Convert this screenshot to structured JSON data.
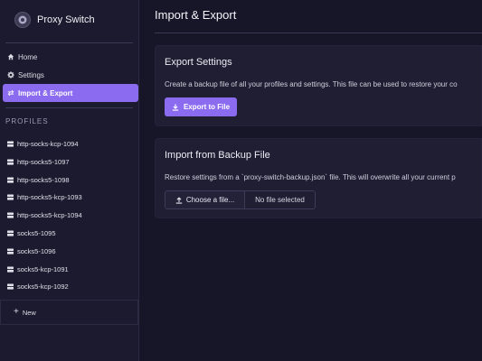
{
  "app": {
    "name": "Proxy Switch"
  },
  "nav": [
    {
      "label": "Home",
      "icon": "home-icon"
    },
    {
      "label": "Settings",
      "icon": "gear-icon"
    },
    {
      "label": "Import & Export",
      "icon": "swap-arrows-icon",
      "active": true
    }
  ],
  "profiles_title": "PROFILES",
  "profiles": [
    "http-socks-kcp-1094",
    "http-socks5-1097",
    "http-socks5-1098",
    "http-socks5-kcp-1093",
    "http-socks5-kcp-1094",
    "socks5-1095",
    "socks5-1096",
    "socks5-kcp-1091",
    "socks5-kcp-1092"
  ],
  "new_label": "New",
  "page": {
    "title": "Import & Export"
  },
  "export": {
    "title": "Export Settings",
    "description": "Create a backup file of all your profiles and settings. This file can be used to restore your co",
    "button": "Export to File"
  },
  "import": {
    "title": "Import from Backup File",
    "description": "Restore settings from a `proxy-switch-backup.json` file. This will overwrite all your current p",
    "choose_button": "Choose a file...",
    "file_status": "No file selected"
  },
  "colors": {
    "accent": "#8b6cf0",
    "background": "#171629",
    "sidebar": "#1b1a2e",
    "card": "#1f1e33"
  }
}
